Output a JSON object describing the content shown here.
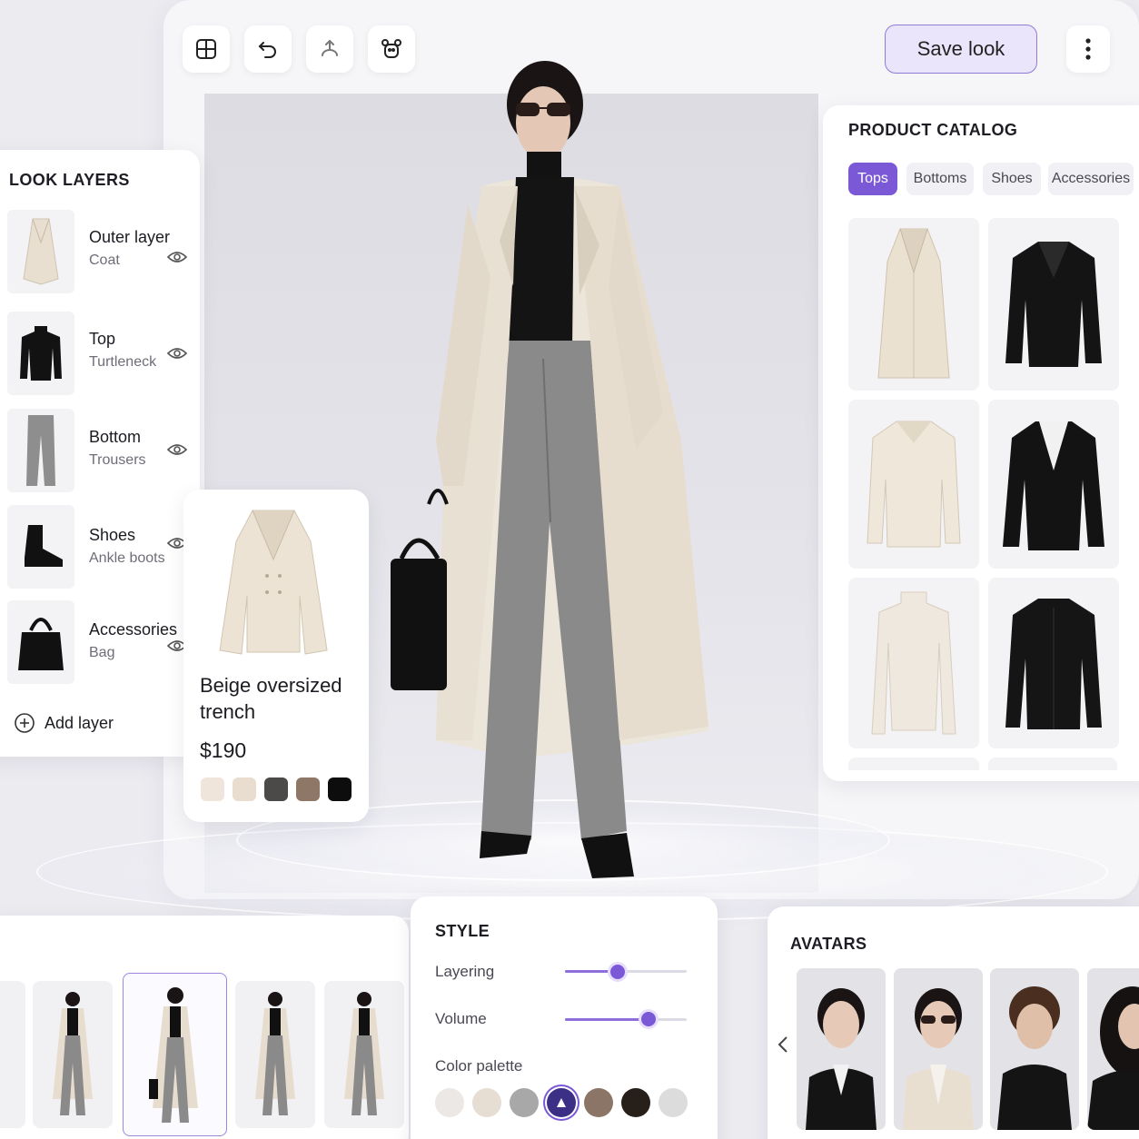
{
  "toolbar": {
    "save_label": "Save look",
    "icons": [
      "layout-icon",
      "undo-icon",
      "share-icon",
      "avatar-icon",
      "more-icon"
    ]
  },
  "look_layers": {
    "title": "LOOK LAYERS",
    "items": [
      {
        "name": "Outer layer",
        "sub": "Coat",
        "icon": "coat-icon"
      },
      {
        "name": "Top",
        "sub": "Turtleneck",
        "icon": "turtleneck-icon"
      },
      {
        "name": "Bottom",
        "sub": "Trousers",
        "icon": "trousers-icon"
      },
      {
        "name": "Shoes",
        "sub": "Ankle boots",
        "icon": "boot-icon"
      },
      {
        "name": "Accessories",
        "sub": "Bag",
        "icon": "bag-icon"
      }
    ],
    "add_label": "Add layer"
  },
  "product": {
    "title_line1": "Beige oversized",
    "title_line2": "trench",
    "price": "$190",
    "swatches": [
      "#efe5da",
      "#e9ddd0",
      "#4b4a48",
      "#8f7768",
      "#0d0d0d"
    ]
  },
  "catalog": {
    "title": "PRODUCT CATALOG",
    "tabs": [
      {
        "label": "Tops",
        "active": true
      },
      {
        "label": "Bottoms",
        "active": false
      },
      {
        "label": "Shoes",
        "active": false
      },
      {
        "label": "Accessories",
        "active": false
      }
    ]
  },
  "style": {
    "title": "STYLE",
    "layering_label": "Layering",
    "layering_value": 0.43,
    "volume_label": "Volume",
    "volume_value": 0.69,
    "palette_label": "Color palette",
    "palette": [
      "#ebe8e5",
      "#e6ddd3",
      "#a8a8a8",
      "#3c2f86",
      "#8b7566",
      "#261f1a",
      "#dcdcdc"
    ],
    "palette_selected": 3
  },
  "avatars": {
    "title": "AVATARS"
  }
}
